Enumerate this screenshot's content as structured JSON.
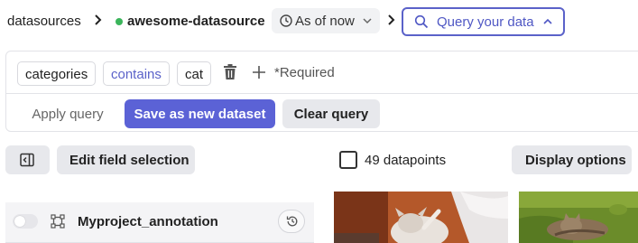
{
  "breadcrumb": {
    "root": "datasources",
    "datasource": "awesome-datasource",
    "time_filter": "As of now",
    "query_button": "Query your data"
  },
  "query": {
    "filter": {
      "field": "categories",
      "operator": "contains",
      "value": "cat"
    },
    "required_label": "*Required",
    "apply_label": "Apply query",
    "save_label": "Save as new dataset",
    "clear_label": "Clear query"
  },
  "toolbar": {
    "edit_fields_label": "Edit field selection",
    "datapoints_label": "49 datapoints",
    "display_options_label": "Display options"
  },
  "annotations": {
    "items": [
      {
        "name": "Myproject_annotation",
        "enabled": false
      }
    ]
  },
  "thumbnails": [
    {
      "alt": "cat on orange blanket"
    },
    {
      "alt": "cat lying in grass"
    }
  ],
  "colors": {
    "accent": "#5b62d6",
    "accent_border": "#5b62c9",
    "status_ok": "#3bb55b",
    "chip_bg": "#e7e8ec"
  }
}
